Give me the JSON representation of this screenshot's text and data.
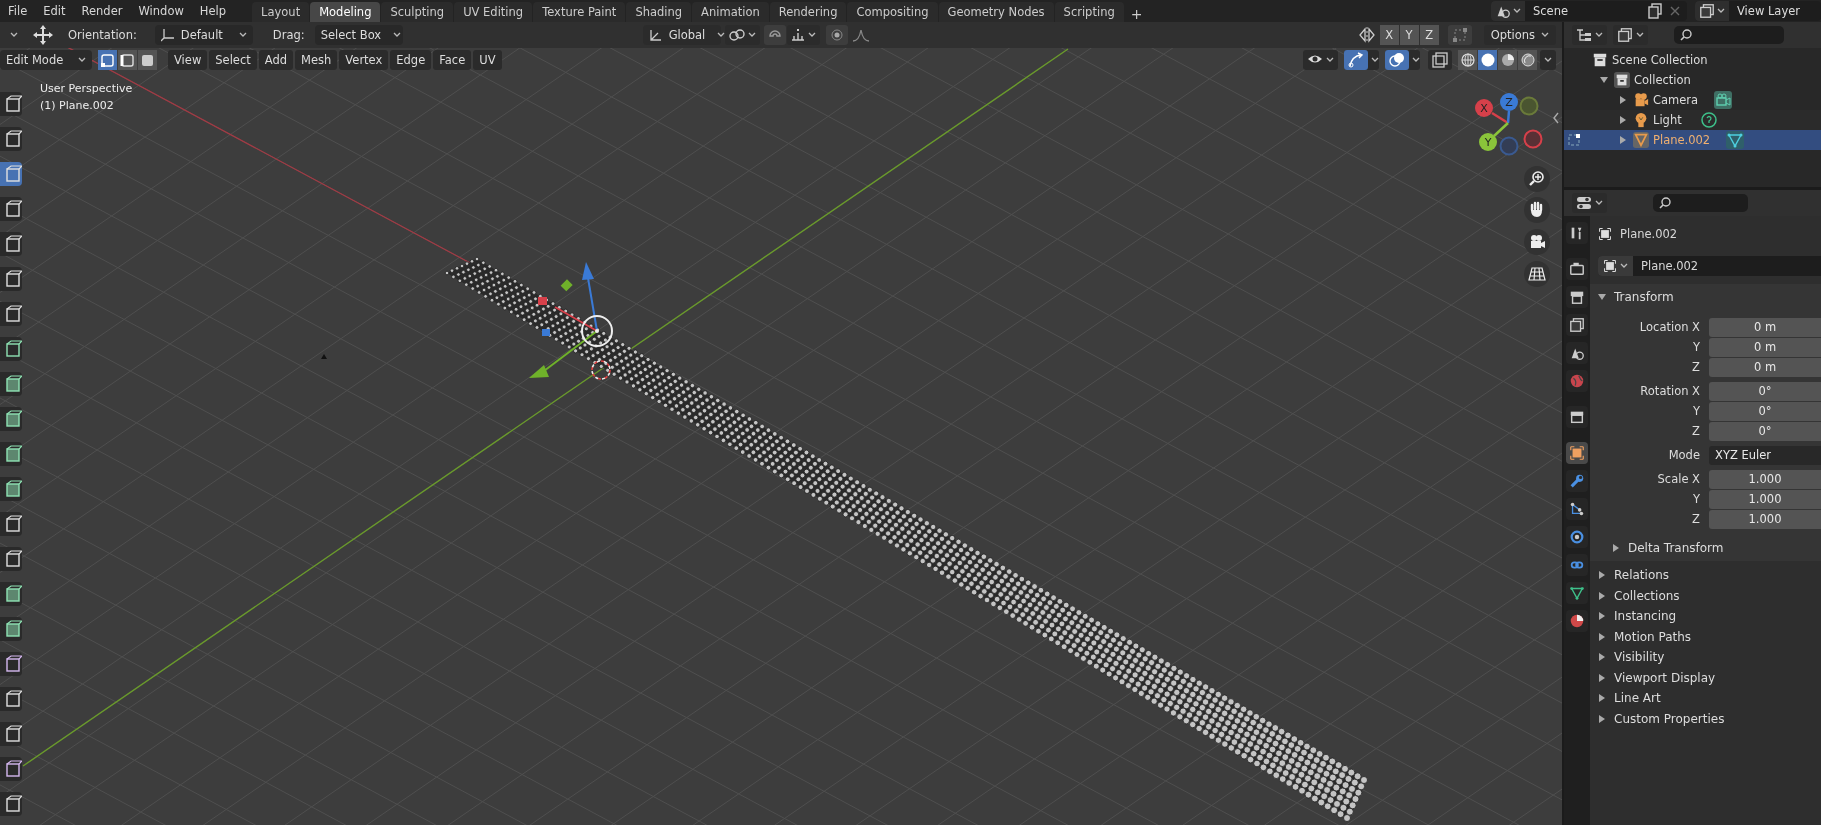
{
  "top_bar": {
    "menu": [
      "File",
      "Edit",
      "Render",
      "Window",
      "Help"
    ],
    "workspaces": [
      {
        "label": "Layout",
        "selected": false
      },
      {
        "label": "Modeling",
        "selected": true
      },
      {
        "label": "Sculpting",
        "selected": false
      },
      {
        "label": "UV Editing",
        "selected": false
      },
      {
        "label": "Texture Paint",
        "selected": false
      },
      {
        "label": "Shading",
        "selected": false
      },
      {
        "label": "Animation",
        "selected": false
      },
      {
        "label": "Rendering",
        "selected": false
      },
      {
        "label": "Compositing",
        "selected": false
      },
      {
        "label": "Geometry Nodes",
        "selected": false
      },
      {
        "label": "Scripting",
        "selected": false
      }
    ],
    "add_tab": "+",
    "scene": "Scene",
    "view_layer": "View Layer"
  },
  "tool_header": {
    "orientation_label": "Orientation:",
    "orientation": "Default",
    "drag_label": "Drag:",
    "drag": "Select Box",
    "transform_orientation": "Global",
    "mirror_axes": [
      "X",
      "Y",
      "Z"
    ],
    "options": "Options"
  },
  "viewport_header": {
    "mode": "Edit Mode",
    "select_modes": [
      {
        "kind": "vertex",
        "selected": true
      },
      {
        "kind": "edge",
        "selected": false
      },
      {
        "kind": "face",
        "selected": false
      }
    ],
    "menus": [
      "View",
      "Select",
      "Add",
      "Mesh",
      "Vertex",
      "Edge",
      "Face",
      "UV"
    ],
    "gizmos_on": true,
    "overlays_on": true,
    "shading": [
      {
        "kind": "wireframe",
        "selected": false
      },
      {
        "kind": "solid",
        "selected": true
      },
      {
        "kind": "material",
        "selected": false
      },
      {
        "kind": "rendered",
        "selected": false
      }
    ]
  },
  "viewport": {
    "view_name": "User Perspective",
    "object_info": "(1) Plane.002",
    "gizmo_axes": [
      "X",
      "Y",
      "Z"
    ]
  },
  "toolbar": {
    "tools": [
      {
        "kind": "tool",
        "selected": false
      },
      {
        "kind": "tool",
        "selected": false
      },
      {
        "kind": "tool",
        "selected": true
      },
      {
        "kind": "tool",
        "selected": false
      },
      {
        "kind": "tool",
        "selected": false
      },
      {
        "kind": "tool",
        "selected": false
      },
      {
        "kind": "tool",
        "selected": false
      },
      {
        "kind": "measure",
        "selected": false
      },
      {
        "kind": "mesh",
        "selected": false
      },
      {
        "kind": "mesh",
        "selected": false
      },
      {
        "kind": "mesh",
        "selected": false
      },
      {
        "kind": "mesh",
        "selected": false
      },
      {
        "kind": "tool",
        "selected": false
      },
      {
        "kind": "tool",
        "selected": false
      },
      {
        "kind": "mesh",
        "selected": false
      },
      {
        "kind": "mesh",
        "selected": false
      },
      {
        "kind": "deform",
        "selected": false
      },
      {
        "kind": "tool",
        "selected": false
      },
      {
        "kind": "tool",
        "selected": false
      },
      {
        "kind": "deform",
        "selected": false
      },
      {
        "kind": "tool",
        "selected": false
      }
    ]
  },
  "outliner": {
    "tree": [
      {
        "label": "Scene Collection",
        "kind": "scene_collection",
        "selected": false,
        "children": [
          {
            "label": "Collection",
            "kind": "collection",
            "expanded": true,
            "selected": false,
            "children": [
              {
                "label": "Camera",
                "kind": "camera",
                "expanded": false,
                "selected": false
              },
              {
                "label": "Light",
                "kind": "light",
                "expanded": false,
                "selected": false
              },
              {
                "label": "Plane.002",
                "kind": "mesh",
                "expanded": false,
                "selected": true
              }
            ]
          }
        ]
      }
    ]
  },
  "properties": {
    "tabs": [
      {
        "kind": "tool",
        "selected": false
      },
      {
        "kind": "render",
        "selected": false
      },
      {
        "kind": "output",
        "selected": false
      },
      {
        "kind": "view_layer",
        "selected": false
      },
      {
        "kind": "scene",
        "selected": false
      },
      {
        "kind": "world",
        "selected": false
      },
      {
        "kind": "collection",
        "selected": false
      },
      {
        "kind": "object",
        "selected": true
      },
      {
        "kind": "modifiers",
        "selected": false
      },
      {
        "kind": "particles",
        "selected": false
      },
      {
        "kind": "physics",
        "selected": false
      },
      {
        "kind": "constraints",
        "selected": false
      },
      {
        "kind": "data",
        "selected": false
      },
      {
        "kind": "material",
        "selected": false
      }
    ],
    "object_name": "Plane.002",
    "data_block": "Plane.002",
    "transform": {
      "title": "Transform",
      "expanded": true,
      "groups": [
        [
          {
            "label": "Location X",
            "value": "0 m",
            "kind": "number"
          },
          {
            "label": "Y",
            "value": "0 m",
            "kind": "number"
          },
          {
            "label": "Z",
            "value": "0 m",
            "kind": "number"
          }
        ],
        [
          {
            "label": "Rotation X",
            "value": "0°",
            "kind": "number"
          },
          {
            "label": "Y",
            "value": "0°",
            "kind": "number"
          },
          {
            "label": "Z",
            "value": "0°",
            "kind": "number"
          }
        ],
        [
          {
            "label": "Mode",
            "value": "XYZ Euler",
            "kind": "dropdown"
          }
        ],
        [
          {
            "label": "Scale X",
            "value": "1.000",
            "kind": "number"
          },
          {
            "label": "Y",
            "value": "1.000",
            "kind": "number"
          },
          {
            "label": "Z",
            "value": "1.000",
            "kind": "number"
          }
        ]
      ],
      "children": [
        {
          "label": "Delta Transform",
          "expanded": false
        }
      ]
    },
    "panels": [
      {
        "label": "Relations",
        "expanded": false
      },
      {
        "label": "Collections",
        "expanded": false
      },
      {
        "label": "Instancing",
        "expanded": false
      },
      {
        "label": "Motion Paths",
        "expanded": false
      },
      {
        "label": "Visibility",
        "expanded": false
      },
      {
        "label": "Viewport Display",
        "expanded": false
      },
      {
        "label": "Line Art",
        "expanded": false
      },
      {
        "label": "Custom Properties",
        "expanded": false
      }
    ]
  }
}
